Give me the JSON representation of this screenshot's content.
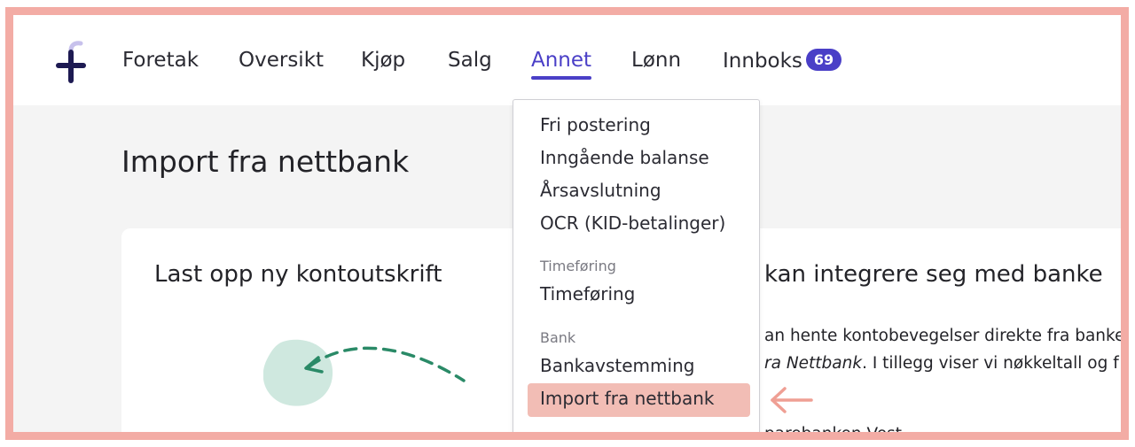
{
  "nav": {
    "items": [
      {
        "label": "Foretak"
      },
      {
        "label": "Oversikt"
      },
      {
        "label": "Kjøp"
      },
      {
        "label": "Salg"
      },
      {
        "label": "Annet",
        "active": true
      },
      {
        "label": "Lønn"
      },
      {
        "label": "Innboks",
        "badge": "69"
      }
    ],
    "accent_color": "#4a3fc7"
  },
  "page": {
    "title": "Import fra nettbank"
  },
  "cards": {
    "left": {
      "heading": "Last opp ny kontoutskrift"
    },
    "right": {
      "heading": "kan integrere seg med banke",
      "line1": "an hente kontobevegelser direkte fra banke",
      "line2_em": "ra Nettbank",
      "line2_rest": ". I tillegg viser vi nøkkeltall og f",
      "line3": "parebanken Vest"
    }
  },
  "dropdown": {
    "items_top": [
      "Fri postering",
      "Inngående balanse",
      "Årsavslutning",
      "OCR (KID-betalinger)"
    ],
    "section_time": "Timeføring",
    "item_time": "Timeføring",
    "section_bank": "Bank",
    "item_bank1": "Bankavstemming",
    "item_bank2": "Import fra nettbank",
    "highlight_color": "#f2bdb5"
  },
  "annotation": {
    "frame_color": "#f3aca5",
    "arrow_icon": "left-arrow-icon"
  }
}
